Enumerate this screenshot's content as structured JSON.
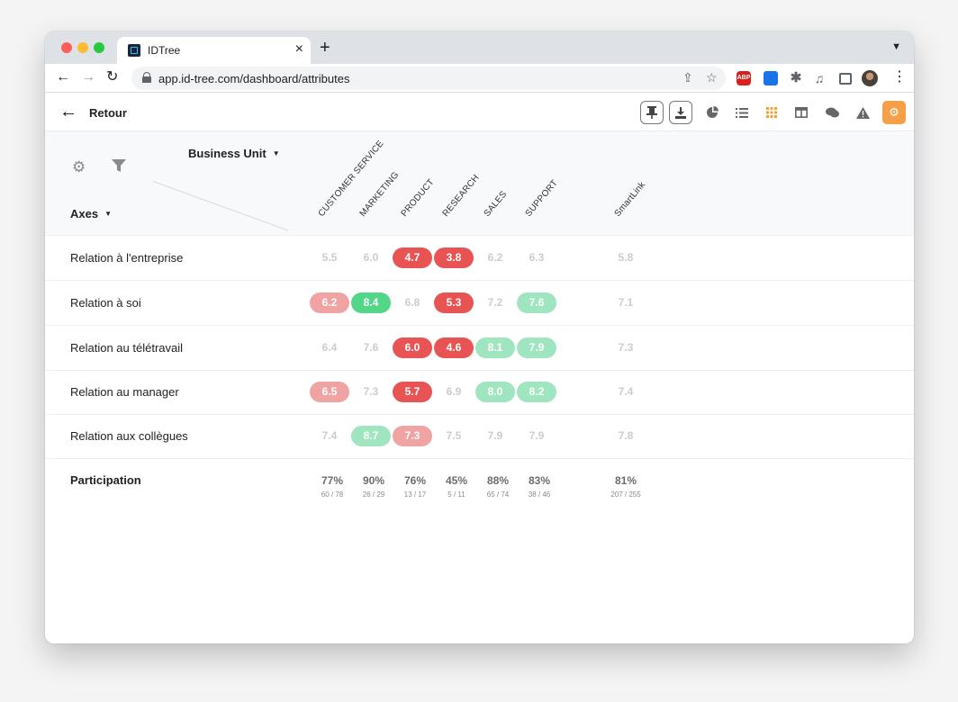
{
  "browser": {
    "tab_title": "IDTree",
    "url": "app.id-tree.com/dashboard/attributes",
    "abp_label": "ABP"
  },
  "appbar": {
    "back_label": "Retour"
  },
  "header": {
    "group_by_label": "Business Unit",
    "axes_label": "Axes",
    "columns": [
      "CUSTOMER SERVICE",
      "MARKETING",
      "PRODUCT",
      "RESEARCH",
      "SALES",
      "SUPPORT",
      "SmartLink"
    ]
  },
  "rows": [
    {
      "label": "Relation à l'entreprise",
      "cells": [
        {
          "value": "5.5",
          "tone": "neutral"
        },
        {
          "value": "6.0",
          "tone": "neutral"
        },
        {
          "value": "4.7",
          "tone": "red"
        },
        {
          "value": "3.8",
          "tone": "red"
        },
        {
          "value": "6.2",
          "tone": "neutral"
        },
        {
          "value": "6.3",
          "tone": "neutral"
        },
        {
          "value": "5.8",
          "tone": "neutral"
        }
      ]
    },
    {
      "label": "Relation à soi",
      "cells": [
        {
          "value": "6.2",
          "tone": "pink"
        },
        {
          "value": "8.4",
          "tone": "green"
        },
        {
          "value": "6.8",
          "tone": "neutral"
        },
        {
          "value": "5.3",
          "tone": "red"
        },
        {
          "value": "7.2",
          "tone": "neutral"
        },
        {
          "value": "7.6",
          "tone": "lightgreen"
        },
        {
          "value": "7.1",
          "tone": "neutral"
        }
      ]
    },
    {
      "label": "Relation au télétravail",
      "cells": [
        {
          "value": "6.4",
          "tone": "neutral"
        },
        {
          "value": "7.6",
          "tone": "neutral"
        },
        {
          "value": "6.0",
          "tone": "red"
        },
        {
          "value": "4.6",
          "tone": "red"
        },
        {
          "value": "8.1",
          "tone": "lightgreen"
        },
        {
          "value": "7.9",
          "tone": "lightgreen"
        },
        {
          "value": "7.3",
          "tone": "neutral"
        }
      ]
    },
    {
      "label": "Relation au manager",
      "cells": [
        {
          "value": "6.5",
          "tone": "pink"
        },
        {
          "value": "7.3",
          "tone": "neutral"
        },
        {
          "value": "5.7",
          "tone": "red"
        },
        {
          "value": "6.9",
          "tone": "neutral"
        },
        {
          "value": "8.0",
          "tone": "lightgreen"
        },
        {
          "value": "8.2",
          "tone": "lightgreen"
        },
        {
          "value": "7.4",
          "tone": "neutral"
        }
      ]
    },
    {
      "label": "Relation aux collègues",
      "cells": [
        {
          "value": "7.4",
          "tone": "neutral"
        },
        {
          "value": "8.7",
          "tone": "lightgreen"
        },
        {
          "value": "7.3",
          "tone": "pink"
        },
        {
          "value": "7.5",
          "tone": "neutral"
        },
        {
          "value": "7.9",
          "tone": "neutral"
        },
        {
          "value": "7.9",
          "tone": "neutral"
        },
        {
          "value": "7.8",
          "tone": "neutral"
        }
      ]
    }
  ],
  "participation": {
    "label": "Participation",
    "cells": [
      {
        "pct": "77%",
        "ratio": "60 / 78"
      },
      {
        "pct": "90%",
        "ratio": "26 / 29"
      },
      {
        "pct": "76%",
        "ratio": "13 / 17"
      },
      {
        "pct": "45%",
        "ratio": "5 / 11"
      },
      {
        "pct": "88%",
        "ratio": "65 / 74"
      },
      {
        "pct": "83%",
        "ratio": "38 / 46"
      },
      {
        "pct": "81%",
        "ratio": "207 / 255"
      }
    ]
  },
  "colors": {
    "red": "#e85454",
    "pink": "#f0a3a3",
    "green": "#52d688",
    "lightgreen": "#9fe5c0",
    "neutral_text": "#c9ccd0",
    "accent_orange": "#f5a048"
  }
}
